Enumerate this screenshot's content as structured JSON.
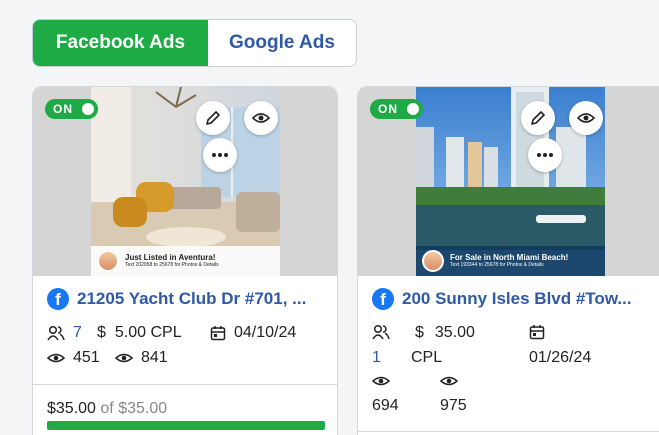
{
  "tabs": [
    {
      "label": "Facebook Ads",
      "active": true
    },
    {
      "label": "Google Ads",
      "active": false
    }
  ],
  "cards": [
    {
      "status": "ON",
      "photo_caption_title": "Just Listed in Aventura!",
      "photo_caption_sub": "Text 202058 to 25678 for Photos & Details",
      "title": "21205 Yacht Club Dr #701, ...",
      "leads": "7",
      "cpl": "5.00 CPL",
      "date": "04/10/24",
      "views": "451",
      "reach": "841",
      "spent": "$35.00",
      "of_label": "of",
      "budget": "$35.00",
      "progress": 1.0
    },
    {
      "status": "ON",
      "photo_caption_title": "For Sale in North Miami Beach!",
      "photo_caption_sub": "Text 193344 to 25678 for Photos & Details",
      "title": "200 Sunny Isles Blvd #Tow...",
      "leads": "1",
      "cpl_amount": "35.00",
      "cpl_unit": "CPL",
      "date": "01/26/24",
      "views": "694",
      "reach": "975"
    }
  ],
  "colors": {
    "accent_green": "#1eaa45",
    "link_blue": "#2e5aa8",
    "facebook_blue": "#1877f2"
  }
}
